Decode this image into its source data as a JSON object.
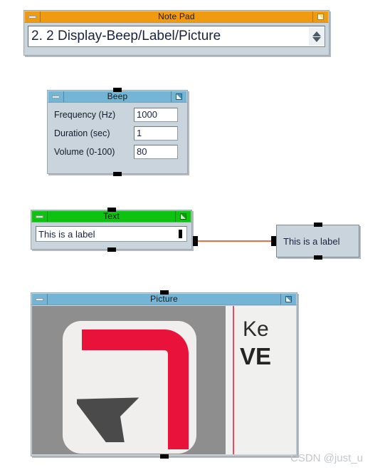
{
  "notepad": {
    "title": "Note Pad",
    "minimize_icon": "minimize-icon",
    "maximize_icon": "maximize-icon",
    "value": "2. 2  Display-Beep/Label/Picture",
    "spinner_up_icon": "chevron-up-icon",
    "spinner_down_icon": "chevron-down-icon",
    "titlebar_color": "#ef9a10"
  },
  "beep": {
    "title": "Beep",
    "minimize_icon": "minimize-icon",
    "maximize_icon": "maximize-icon",
    "titlebar_color": "#74b4d4",
    "fields": [
      {
        "label": "Frequency (Hz)",
        "value": "1000"
      },
      {
        "label": "Duration (sec)",
        "value": "1"
      },
      {
        "label": "Volume (0-100)",
        "value": "80"
      }
    ]
  },
  "text_window": {
    "title": "Text",
    "minimize_icon": "minimize-icon",
    "maximize_icon": "maximize-icon",
    "titlebar_color": "#0dc211",
    "value": "This is a label",
    "output_port": "output-port",
    "wire_color": "#e8714a"
  },
  "label_node": {
    "text": "This is a label",
    "input_port": "input-port"
  },
  "picture": {
    "title": "Picture",
    "minimize_icon": "minimize-icon",
    "maximize_icon": "maximize-icon",
    "titlebar_color": "#74b4d4",
    "image": {
      "logo_icon": "cursor-arrow-logo",
      "arc_color": "#e8123a",
      "cursor_color": "#4a4a4a",
      "rule_color": "#e84a63",
      "heading_text": "Ke",
      "subheading_text": "VE"
    }
  },
  "watermark": {
    "text": "CSDN @just_u"
  }
}
